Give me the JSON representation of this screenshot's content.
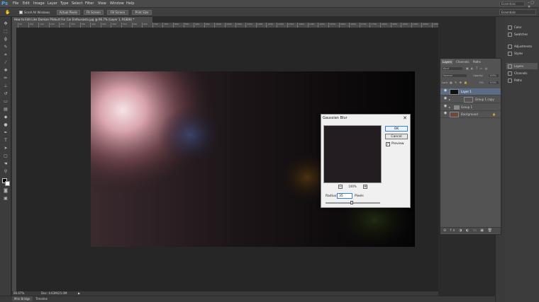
{
  "app": {
    "logo": "Ps"
  },
  "menu": [
    "File",
    "Edit",
    "Image",
    "Layer",
    "Type",
    "Select",
    "Filter",
    "View",
    "Window",
    "Help"
  ],
  "search": {
    "placeholder": "Essentials"
  },
  "window_controls": "– ▢ ✕",
  "options": {
    "scroll_all_windows": "Scroll All Windows",
    "buttons": [
      "Actual Pixels",
      "Fit Screen",
      "Fill Screen",
      "Print Size"
    ],
    "workspace": "Essentials"
  },
  "document": {
    "tab_title": "How to Edit Like Damian Pilskurt For Car Enthusiasts.jpg @ 66.7% (Layer 1, RGB/8) *",
    "ruler_ticks": [
      "50",
      "100",
      "150",
      "200",
      "250",
      "300",
      "350",
      "400",
      "450",
      "500",
      "550",
      "600",
      "650",
      "700",
      "750",
      "800",
      "850",
      "900",
      "950",
      "1000",
      "1050",
      "1100",
      "1150",
      "1200",
      "1250",
      "1300",
      "1350",
      "1400",
      "1450",
      "1500",
      "1550",
      "1600",
      "1650",
      "1700",
      "1750",
      "1800",
      "1850",
      "1900",
      "1950",
      "2000",
      "2050"
    ]
  },
  "status": {
    "zoom": "66.67%",
    "doc_size": "Doc: 4.63M/25.0M"
  },
  "bottom_tabs": [
    "Mini Bridge",
    "Timeline"
  ],
  "right_dock": {
    "group1": [
      "Color",
      "Swatches"
    ],
    "group2": [
      "Adjustments",
      "Styles"
    ],
    "group3": [
      "Layers",
      "Channels",
      "Paths"
    ]
  },
  "layers_panel": {
    "tabs": [
      "Layers",
      "Channels",
      "Paths"
    ],
    "kind": "Kind",
    "blend_mode": "Normal",
    "opacity_label": "Opacity:",
    "opacity_value": "100%",
    "lock_label": "Lock:",
    "fill_label": "Fill:",
    "fill_value": "100%",
    "layers": [
      {
        "name": "Layer 1",
        "selected": true
      },
      {
        "name": "Group 1 copy",
        "selected": false
      },
      {
        "name": "Group 1",
        "selected": false
      },
      {
        "name": "Background",
        "selected": false
      }
    ],
    "footer_icons": "⊖ fx ◑ ◐ ▭ ▣ 🗑"
  },
  "dialog": {
    "title": "Gaussian Blur",
    "close": "✕",
    "ok": "OK",
    "cancel": "Cancel",
    "preview_label": "Preview",
    "preview_checked": "✓",
    "zoom_out": "−",
    "zoom_in": "+",
    "zoom_percent": "100%",
    "radius_label": "Radius:",
    "radius_value": "35",
    "radius_unit": "Pixels"
  },
  "colors": {
    "accent": "#3a7fd0",
    "selected_layer": "#5a6d85"
  }
}
